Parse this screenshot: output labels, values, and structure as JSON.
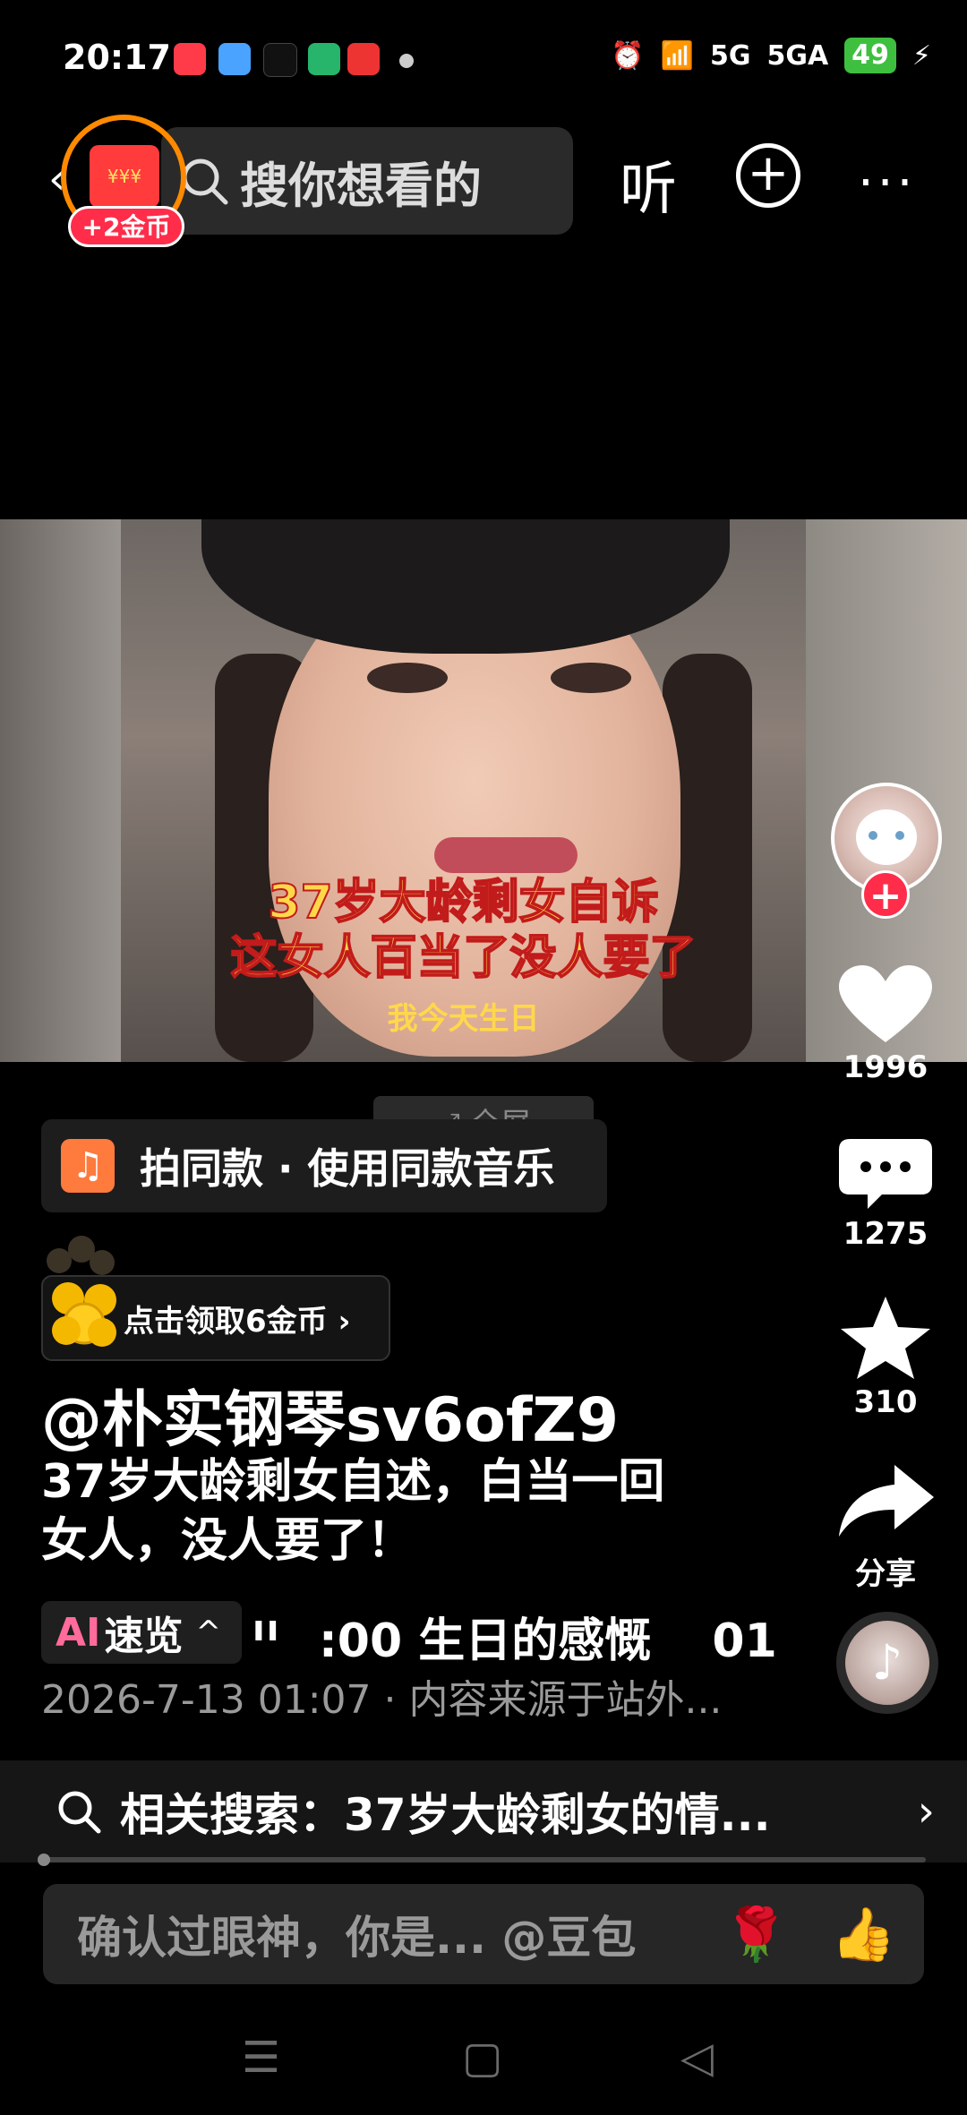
{
  "status_bar": {
    "time": "20:17",
    "network_5g": "5G",
    "network_5ga": "5GA",
    "battery": "49"
  },
  "top_bar": {
    "coin_badge": "+2金币",
    "search_placeholder": "搜你想看的",
    "listen_label": "听",
    "more_label": "···"
  },
  "video": {
    "caption_line1": "37岁大龄剩女自诉",
    "caption_line2": "这女人百当了没人要了",
    "caption_line3": "我今天生日",
    "fullscreen_label": "全屏"
  },
  "music_bar": {
    "label": "拍同款 · 使用同款音乐"
  },
  "coin_task": {
    "label": "点击领取6金币 ›"
  },
  "post": {
    "author": "@朴实钢琴sv6ofZ9",
    "description_line1": "37岁大龄剩女自述，白当一回",
    "description_line2": "女人，没人要了！",
    "ai_label": "AI",
    "ai_speed": "速览",
    "ai_caret": "^",
    "ai_time1": ":00",
    "ai_topic": "生日的感慨",
    "ai_time2": "01",
    "meta": "2026-7-13 01:07 · 内容来源于站外..."
  },
  "rail": {
    "likes": "1996",
    "comments": "1275",
    "favorites": "310",
    "share": "分享"
  },
  "related_search": {
    "label": "相关搜索：37岁大龄剩女的情..."
  },
  "comment_bar": {
    "placeholder": "确认过眼神，你是... @豆包"
  }
}
